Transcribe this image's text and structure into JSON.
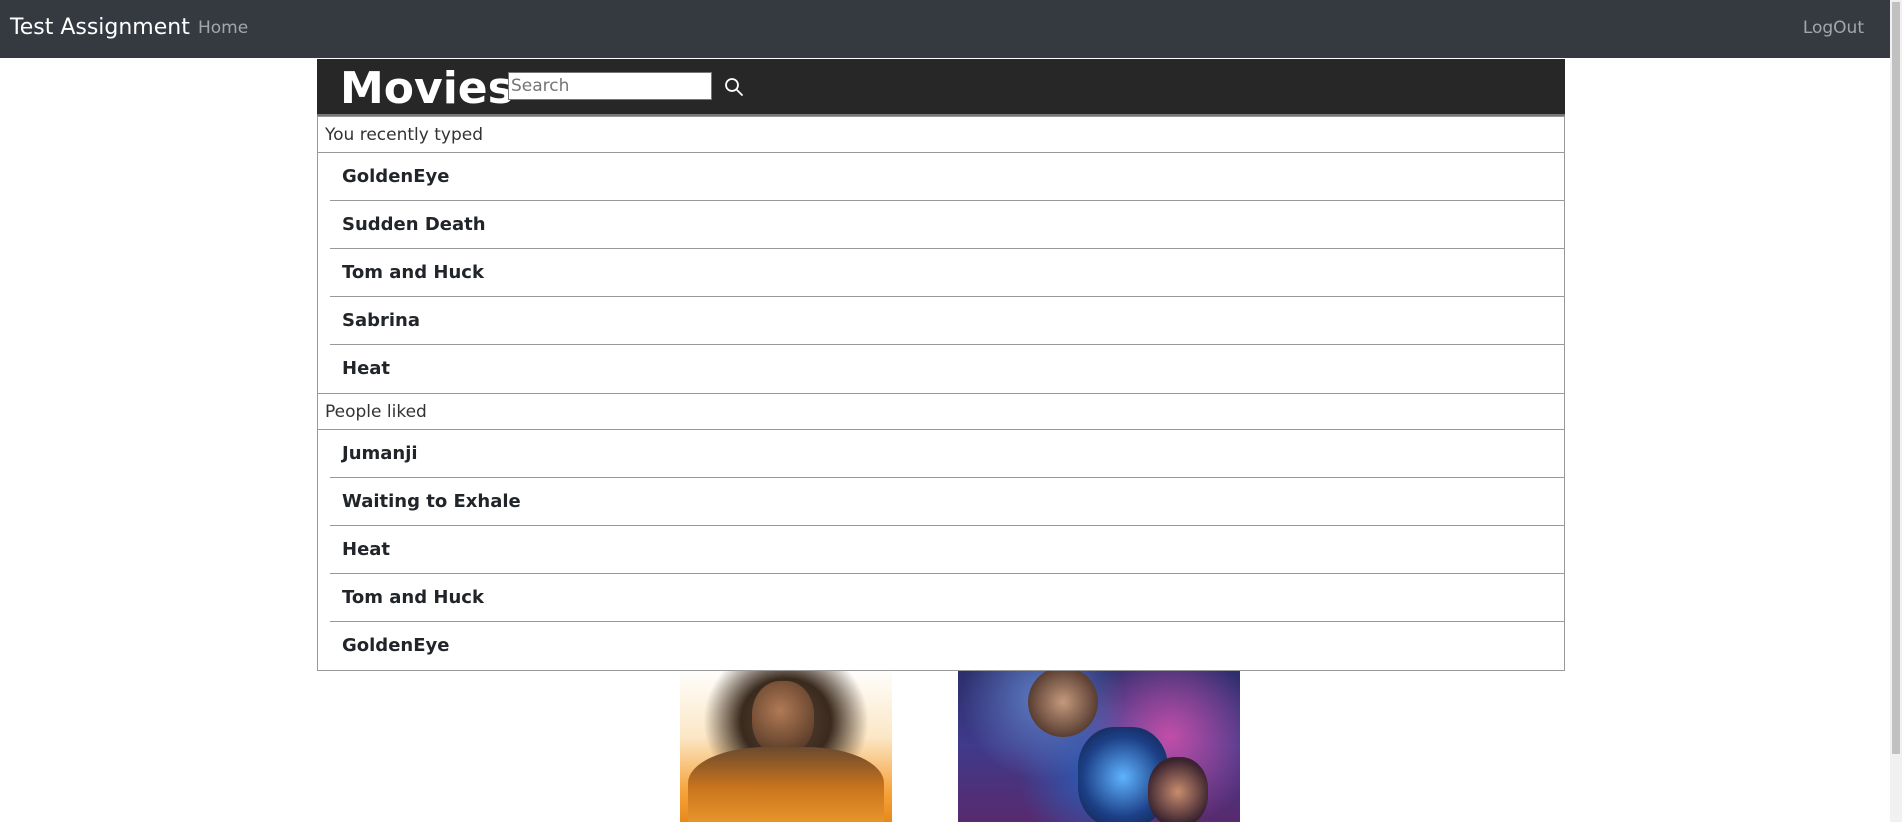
{
  "navbar": {
    "brand": "Test Assignment",
    "home_label": "Home",
    "logout_label": "LogOut"
  },
  "movies_header": {
    "title": "Movies",
    "search_placeholder": "Search",
    "search_value": ""
  },
  "dropdown": {
    "recent": {
      "label": "You recently typed",
      "items": [
        "GoldenEye",
        "Sudden Death",
        "Tom and Huck",
        "Sabrina",
        "Heat"
      ]
    },
    "liked": {
      "label": "People liked",
      "items": [
        "Jumanji",
        "Waiting to Exhale",
        "Heat",
        "Tom and Huck",
        "GoldenEye"
      ]
    }
  },
  "posters": [
    "movie-poster-orange-man",
    "movie-poster-blue-beetle"
  ],
  "colors": {
    "navbar_bg": "#343a40",
    "movies_header_bg": "#272727"
  }
}
